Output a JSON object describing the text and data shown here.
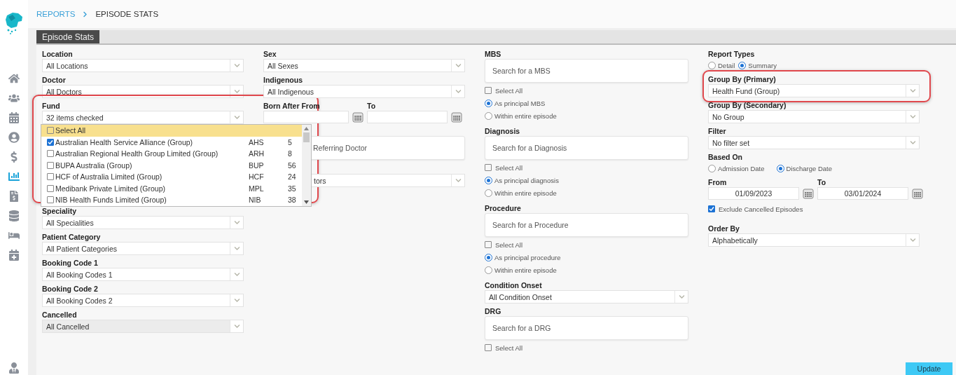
{
  "sidebar": {
    "items": [
      {
        "selected": false
      },
      {
        "selected": false
      },
      {
        "selected": false
      },
      {
        "selected": false
      },
      {
        "selected": false
      },
      {
        "selected": true
      },
      {
        "selected": false
      },
      {
        "selected": false
      },
      {
        "selected": false
      },
      {
        "selected": false
      }
    ],
    "footer_items": [
      {
        "selected": false
      }
    ]
  },
  "breadcrumb": [
    {
      "label": "REPORTS",
      "link": true
    },
    {
      "label": "EPISODE STATS",
      "link": false
    }
  ],
  "tab": {
    "label": "Episode Stats",
    "selected": true
  },
  "columns": [
    [
      {
        "kind": "select",
        "label": "Location",
        "value": "All Locations",
        "disabled": false
      },
      {
        "kind": "select",
        "label": "Doctor",
        "value": "All Doctors",
        "disabled": false
      },
      {
        "kind": "multiselect",
        "label": "Fund",
        "value": "32 items checked",
        "highlighted": true,
        "list": {
          "select_all": {
            "label": "Select All",
            "checked": false
          },
          "items": [
            {
              "name": "Australian Health Service Alliance (Group)",
              "code": "AHS",
              "count": "5",
              "checked": true
            },
            {
              "name": "Australian Regional Health Group Limited (Group)",
              "code": "ARH",
              "count": "8",
              "checked": false
            },
            {
              "name": "BUPA Australia (Group)",
              "code": "BUP",
              "count": "56",
              "checked": false
            },
            {
              "name": "HCF of Australia Limited (Group)",
              "code": "HCF",
              "count": "24",
              "checked": false
            },
            {
              "name": "Medibank Private Limited (Group)",
              "code": "MPL",
              "count": "35",
              "checked": false
            },
            {
              "name": "NIB Health Funds Limited (Group)",
              "code": "NIB",
              "count": "38",
              "checked": false
            }
          ]
        }
      },
      {
        "kind": "select",
        "label": "Speciality",
        "value": "All Specialities",
        "disabled": false
      },
      {
        "kind": "select",
        "label": "Patient Category",
        "value": "All Patient Categories",
        "disabled": false
      },
      {
        "kind": "select",
        "label": "Booking Code 1",
        "value": "All Booking Codes 1",
        "disabled": false
      },
      {
        "kind": "select",
        "label": "Booking Code 2",
        "value": "All Booking Codes 2",
        "disabled": false
      },
      {
        "kind": "select",
        "label": "Cancelled",
        "value": "All Cancelled",
        "disabled": true
      }
    ],
    [
      {
        "kind": "select",
        "label": "Sex",
        "value": "All Sexes",
        "disabled": false
      },
      {
        "kind": "select",
        "label": "Indigenous",
        "value": "All Indigenous",
        "disabled": false
      },
      {
        "kind": "date_range",
        "from_label": "Born After From",
        "to_label": "To"
      },
      {
        "kind": "search",
        "placeholder": "Referring Doctor",
        "partly_covered": true
      },
      {
        "kind": "select",
        "value": "tors",
        "disabled": false,
        "partly_covered": true
      }
    ],
    [
      {
        "kind": "search",
        "label": "MBS",
        "placeholder": "Search for a MBS",
        "select_all": {
          "label": "Select All",
          "checked": false
        },
        "radios": [
          {
            "label": "As principal MBS",
            "selected": true
          },
          {
            "label": "Within entire episode",
            "selected": false
          }
        ]
      },
      {
        "kind": "search",
        "label": "Diagnosis",
        "placeholder": "Search for a Diagnosis",
        "select_all": {
          "label": "Select All",
          "checked": false
        },
        "radios": [
          {
            "label": "As principal diagnosis",
            "selected": true
          },
          {
            "label": "Within entire episode",
            "selected": false
          }
        ]
      },
      {
        "kind": "search",
        "label": "Procedure",
        "placeholder": "Search for a Procedure",
        "select_all": {
          "label": "Select All",
          "checked": false
        },
        "radios": [
          {
            "label": "As principal procedure",
            "selected": true
          },
          {
            "label": "Within entire episode",
            "selected": false
          }
        ]
      },
      {
        "kind": "select",
        "label": "Condition Onset",
        "value": "All Condition Onset",
        "disabled": false
      },
      {
        "kind": "search",
        "label": "DRG",
        "placeholder": "Search for a DRG",
        "select_all": {
          "label": "Select All",
          "checked": false
        }
      }
    ],
    [
      {
        "kind": "radio_group",
        "label": "Report Types",
        "options": [
          {
            "label": "Detail",
            "selected": false
          },
          {
            "label": "Summary",
            "selected": true
          }
        ]
      },
      {
        "kind": "select",
        "label": "Group By (Primary)",
        "value": "Health Fund (Group)",
        "disabled": false,
        "highlighted": true
      },
      {
        "kind": "select",
        "label": "Group By (Secondary)",
        "value": "No Group",
        "disabled": false
      },
      {
        "kind": "select",
        "label": "Filter",
        "value": "No filter set",
        "disabled": false
      },
      {
        "kind": "radio_group",
        "label": "Based On",
        "options": [
          {
            "label": "Admission Date",
            "selected": false
          },
          {
            "label": "Discharge Date",
            "selected": true
          }
        ]
      },
      {
        "kind": "date_range",
        "from_label": "From",
        "to_label": "To",
        "from_value": "01/09/2023",
        "to_value": "03/01/2024"
      },
      {
        "kind": "checkbox",
        "label": "Exclude Cancelled Episodes",
        "checked": true
      },
      {
        "kind": "select",
        "label": "Order By",
        "value": "Alphabetically",
        "disabled": false
      }
    ]
  ],
  "update_button": {
    "label": "Update"
  }
}
